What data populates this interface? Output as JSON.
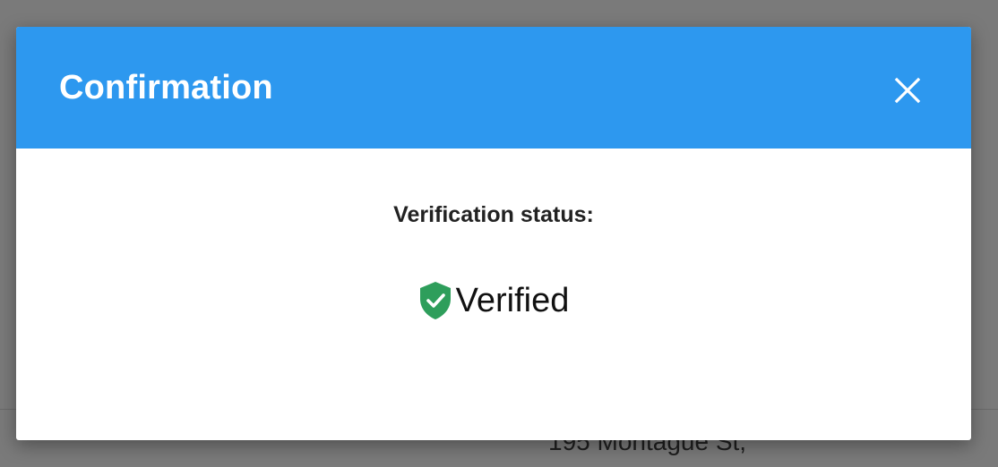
{
  "background": {
    "address_text": "195 Montague St,"
  },
  "modal": {
    "title": "Confirmation",
    "close_icon": "close-icon",
    "status_label": "Verification status:",
    "status_value": "Verified",
    "status_icon": "shield-check-icon",
    "colors": {
      "header": "#2d98ef",
      "shield": "#2e9e5b"
    }
  }
}
